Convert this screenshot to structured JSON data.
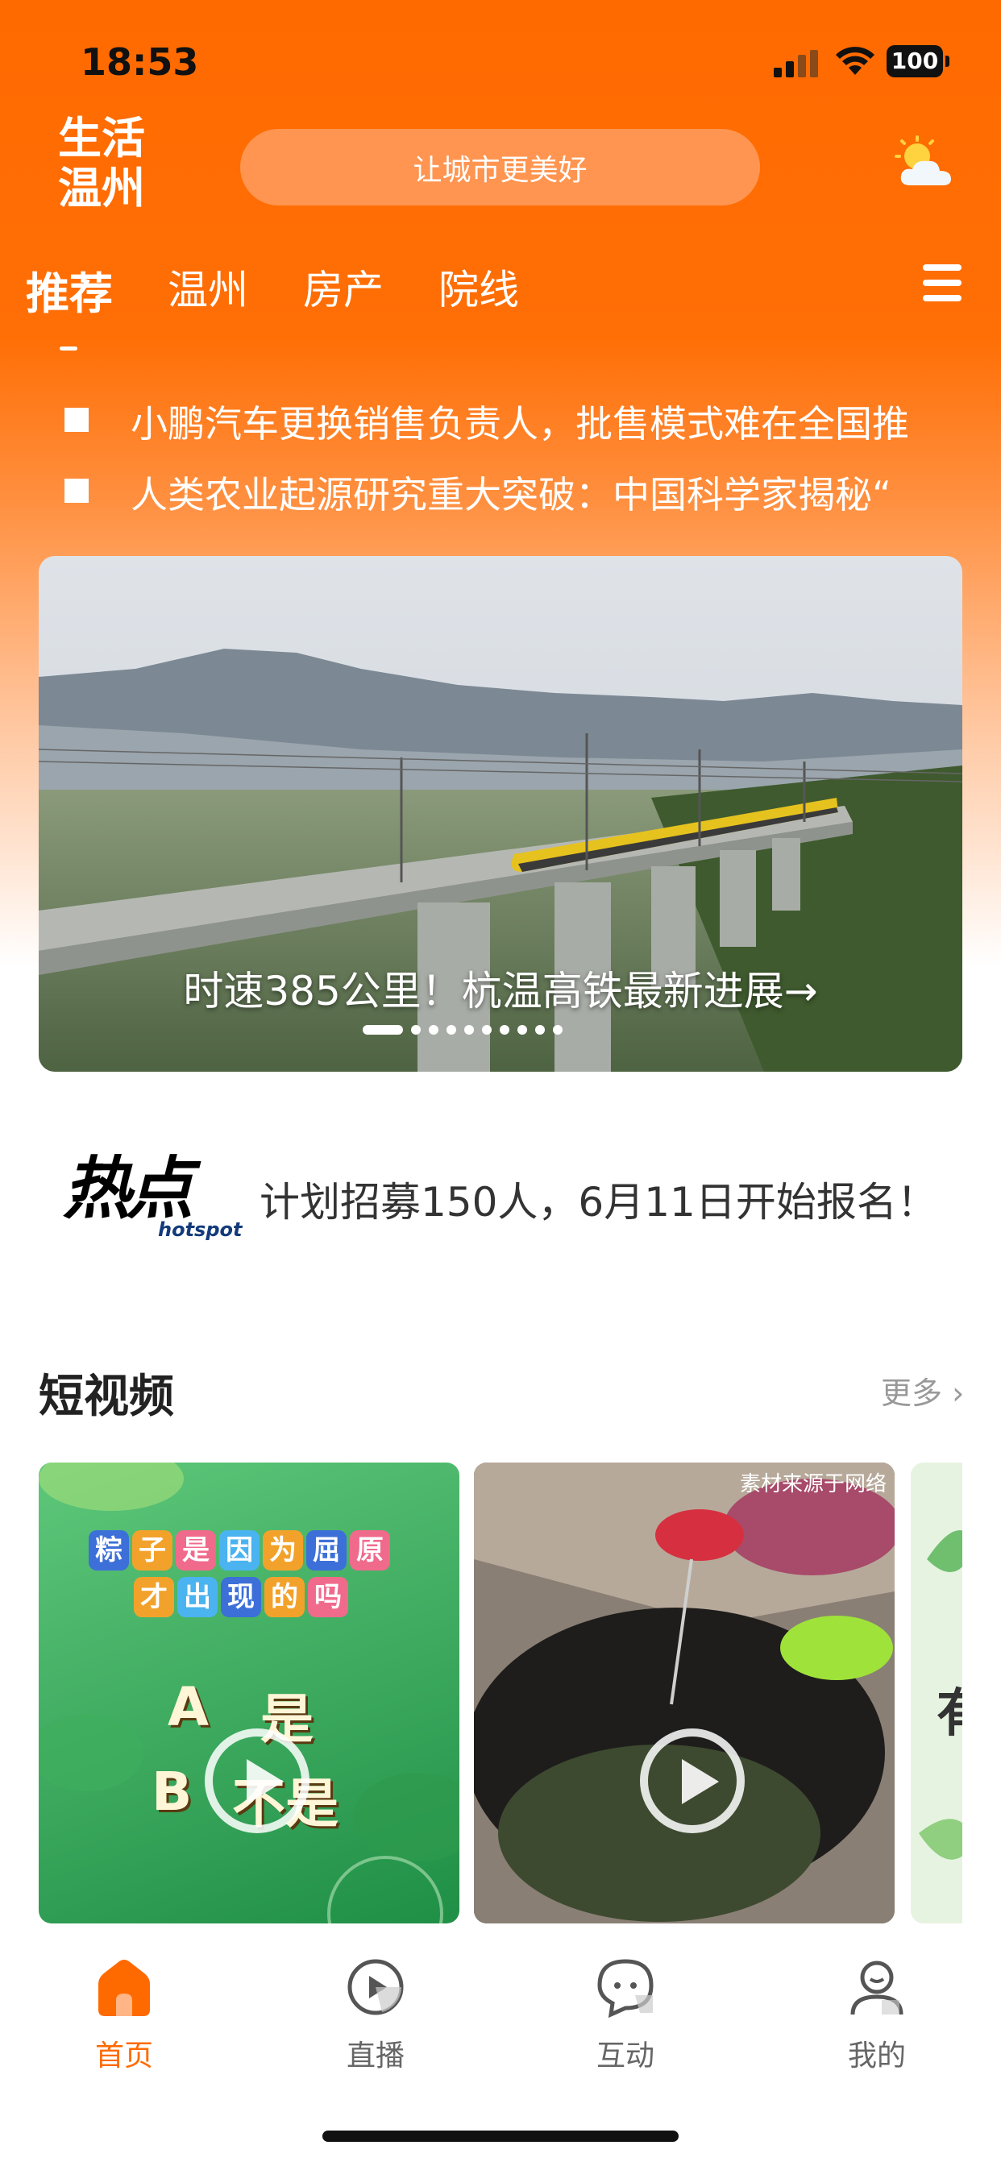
{
  "status_bar": {
    "time": "18:53",
    "battery": "100"
  },
  "header": {
    "logo_lines": [
      "生活",
      "温州"
    ],
    "search_placeholder": "让城市更美好",
    "weather_icon": "partly-cloudy-icon"
  },
  "tabs": [
    {
      "label": "推荐",
      "active": true
    },
    {
      "label": "温州",
      "active": false
    },
    {
      "label": "房产",
      "active": false
    },
    {
      "label": "院线",
      "active": false
    }
  ],
  "ticker": [
    "小鹏汽车更换销售负责人，批售模式难在全国推",
    "人类农业起源研究重大突破：中国科学家揭秘“"
  ],
  "banner": {
    "caption": "时速385公里！杭温高铁最新进展→",
    "slide_count": 10,
    "active_slide": 1
  },
  "hotspot": {
    "logo_cn": "热点",
    "logo_en": "hotspot",
    "text": "计划招募150人，6月11日开始报名！"
  },
  "short_video": {
    "title": "短视频",
    "more": "更多",
    "videos": [
      {
        "tiles_row1": [
          "粽",
          "子",
          "是",
          "因",
          "为",
          "屈",
          "原"
        ],
        "tiles_row2": [
          "才",
          "出",
          "现",
          "的",
          "吗"
        ],
        "word_a": "A",
        "word_is": "是",
        "word_b": "B",
        "word_not": "不是"
      },
      {
        "tag": "素材来源于网络"
      },
      {
        "partial_char": "有"
      }
    ]
  },
  "bottom_nav": [
    {
      "label": "首页",
      "icon": "home-icon",
      "active": true
    },
    {
      "label": "直播",
      "icon": "live-play-icon",
      "active": false
    },
    {
      "label": "互动",
      "icon": "chat-bubble-icon",
      "active": false
    },
    {
      "label": "我的",
      "icon": "user-icon",
      "active": false
    }
  ],
  "colors": {
    "accent": "#ff6a00",
    "hot_red": "#e8361e",
    "hot_blue": "#133a7a"
  }
}
